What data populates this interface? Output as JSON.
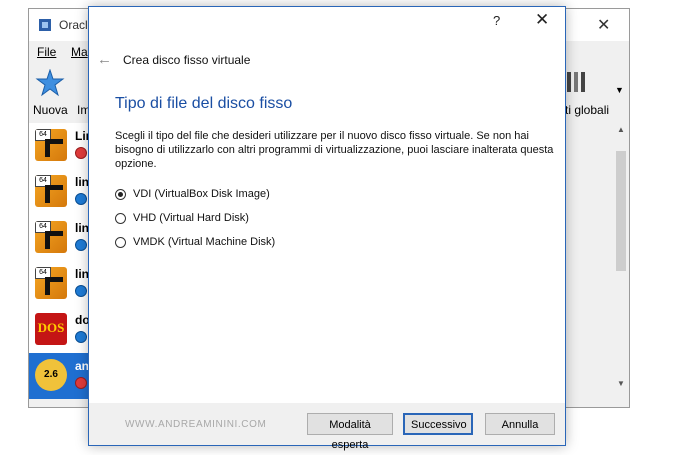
{
  "background_window": {
    "title": "Oracle",
    "menu": [
      "File",
      "Ma"
    ],
    "toolbar": {
      "new_label": "Nuova",
      "import_label": "Im",
      "global_label": "ti globali"
    },
    "vms": [
      {
        "name": "Lin",
        "badge": "64",
        "state": "stopped",
        "icon": "linux-64-icon"
      },
      {
        "name": "lin",
        "badge": "64",
        "state": "power",
        "icon": "linux-64-icon"
      },
      {
        "name": "lin",
        "badge": "64",
        "state": "power",
        "icon": "linux-64-icon"
      },
      {
        "name": "lin",
        "badge": "64",
        "state": "power",
        "icon": "linux-64-icon"
      },
      {
        "name": "do",
        "badge": "DOS",
        "state": "power",
        "icon": "dos-icon"
      },
      {
        "name": "an",
        "badge": "2.6",
        "state": "stopped",
        "icon": "linux-26-icon",
        "selected": true
      }
    ]
  },
  "dialog": {
    "help_label": "?",
    "close_label": "✕",
    "back_icon": "←",
    "wizard_title": "Crea disco fisso virtuale",
    "heading": "Tipo di file del disco fisso",
    "description": "Scegli il tipo del file che desideri utilizzare per il nuovo disco fisso virtuale. Se non hai bisogno di utilizzarlo con altri programmi di virtualizzazione, puoi lasciare inalterata questa opzione.",
    "options": [
      {
        "label": "VDI (VirtualBox Disk Image)",
        "checked": true
      },
      {
        "label": "VHD (Virtual Hard Disk)",
        "checked": false
      },
      {
        "label": "VMDK (Virtual Machine Disk)",
        "checked": false
      }
    ],
    "watermark": "WWW.ANDREAMININI.COM",
    "buttons": {
      "expert": "Modalità esperta",
      "next": "Successivo",
      "cancel": "Annulla"
    }
  },
  "colors": {
    "accent": "#2a66b8",
    "heading": "#1a4ea3",
    "selected_row": "#1f6fd1"
  }
}
